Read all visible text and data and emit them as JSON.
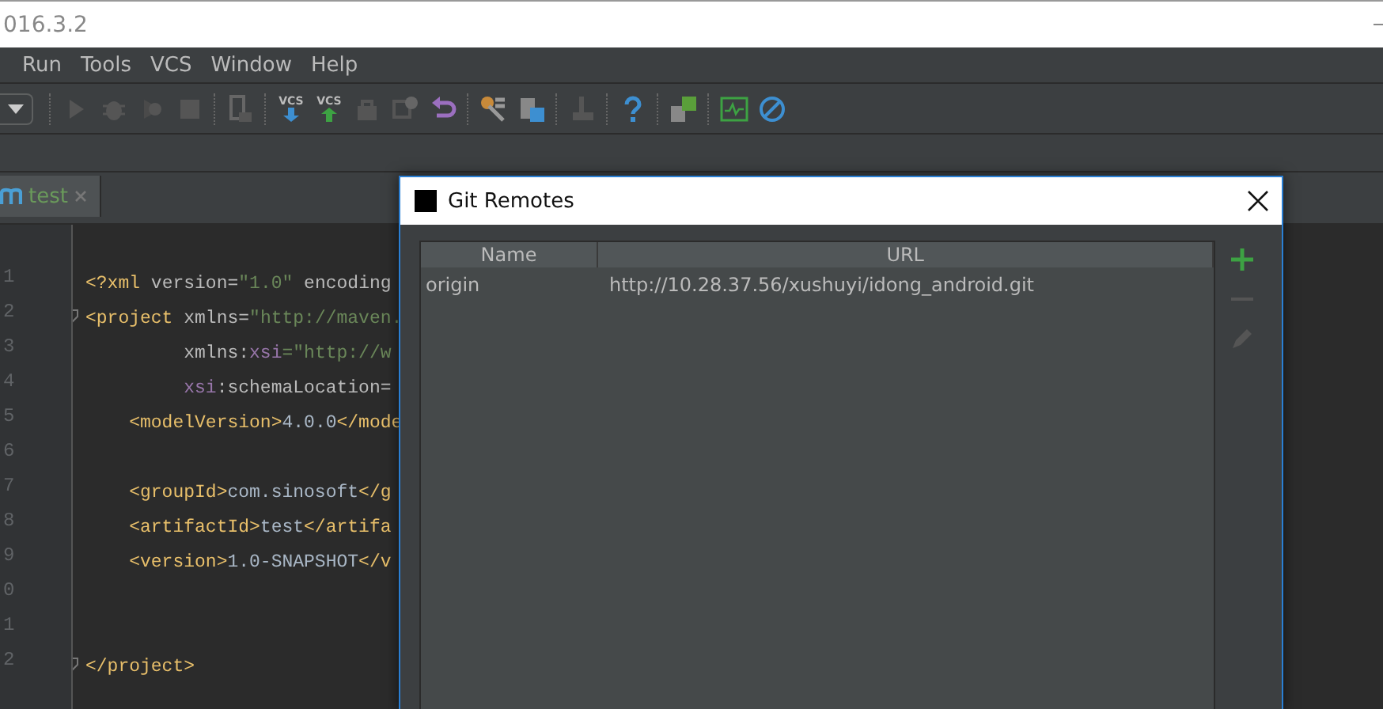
{
  "window": {
    "title": "016.3.2"
  },
  "menu": [
    {
      "label": "Run"
    },
    {
      "label": "Tools"
    },
    {
      "label": "VCS"
    },
    {
      "label": "Window"
    },
    {
      "label": "Help"
    }
  ],
  "toolbar": [
    {
      "kind": "dropdown"
    },
    {
      "kind": "sep"
    },
    {
      "kind": "run"
    },
    {
      "kind": "debug"
    },
    {
      "kind": "coverage"
    },
    {
      "kind": "stop"
    },
    {
      "kind": "sep"
    },
    {
      "kind": "device"
    },
    {
      "kind": "sep"
    },
    {
      "kind": "vcs-update",
      "label": "VCS"
    },
    {
      "kind": "vcs-commit",
      "label": "VCS"
    },
    {
      "kind": "compare"
    },
    {
      "kind": "history"
    },
    {
      "kind": "revert"
    },
    {
      "kind": "sep"
    },
    {
      "kind": "settings"
    },
    {
      "kind": "structure"
    },
    {
      "kind": "sep"
    },
    {
      "kind": "sdk"
    },
    {
      "kind": "sep"
    },
    {
      "kind": "help"
    },
    {
      "kind": "sep"
    },
    {
      "kind": "sync"
    },
    {
      "kind": "sep"
    },
    {
      "kind": "monitor"
    },
    {
      "kind": "block"
    }
  ],
  "tabs": [
    {
      "label": "test",
      "selected": true
    }
  ],
  "editor": {
    "lines": [
      {
        "number": "1",
        "segments": [
          {
            "kind": "tag",
            "text": "<?xml "
          },
          {
            "kind": "attr",
            "text": "version="
          },
          {
            "kind": "value",
            "text": "\"1.0\""
          },
          {
            "kind": "attr",
            "text": " encoding"
          }
        ]
      },
      {
        "number": "2",
        "fold": true,
        "segments": [
          {
            "kind": "tag",
            "text": "<project "
          },
          {
            "kind": "attr",
            "text": "xmlns="
          },
          {
            "kind": "value",
            "text": "\"http://maven."
          }
        ]
      },
      {
        "number": "3",
        "segments": [
          {
            "kind": "attr",
            "text": "         xmlns:"
          },
          {
            "kind": "ns",
            "text": "xsi"
          },
          {
            "kind": "value",
            "text": "=\"http://w"
          }
        ]
      },
      {
        "number": "4",
        "segments": [
          {
            "kind": "ns",
            "text": "         xsi"
          },
          {
            "kind": "attr",
            "text": ":schemaLocation="
          }
        ]
      },
      {
        "number": "5",
        "segments": [
          {
            "kind": "tag",
            "text": "    <modelVersion>"
          },
          {
            "kind": "text",
            "text": "4.0.0"
          },
          {
            "kind": "tag",
            "text": "</mode"
          }
        ]
      },
      {
        "number": "6"
      },
      {
        "number": "7",
        "segments": [
          {
            "kind": "tag",
            "text": "    <groupId>"
          },
          {
            "kind": "text",
            "text": "com.sinosoft"
          },
          {
            "kind": "tag",
            "text": "</g"
          }
        ]
      },
      {
        "number": "8",
        "segments": [
          {
            "kind": "tag",
            "text": "    <artifactId>"
          },
          {
            "kind": "text",
            "text": "test"
          },
          {
            "kind": "tag",
            "text": "</artifa"
          }
        ]
      },
      {
        "number": "9",
        "segments": [
          {
            "kind": "tag",
            "text": "    <version>"
          },
          {
            "kind": "text",
            "text": "1.0-SNAPSHOT"
          },
          {
            "kind": "tag",
            "text": "</v"
          }
        ]
      },
      {
        "number": "0"
      },
      {
        "number": "1"
      },
      {
        "number": "2",
        "fold": true,
        "segments": [
          {
            "kind": "tag",
            "text": "</project>"
          }
        ]
      }
    ]
  },
  "dialog": {
    "title": "Git Remotes",
    "columns": [
      "Name",
      "URL"
    ],
    "rows": [
      {
        "name": "origin",
        "url": "http://10.28.37.56/xushuyi/idong_android.git",
        "selected": false
      }
    ],
    "actions": [
      {
        "kind": "add",
        "disabled": false
      },
      {
        "kind": "remove",
        "disabled": true
      },
      {
        "kind": "edit",
        "disabled": true
      }
    ]
  }
}
